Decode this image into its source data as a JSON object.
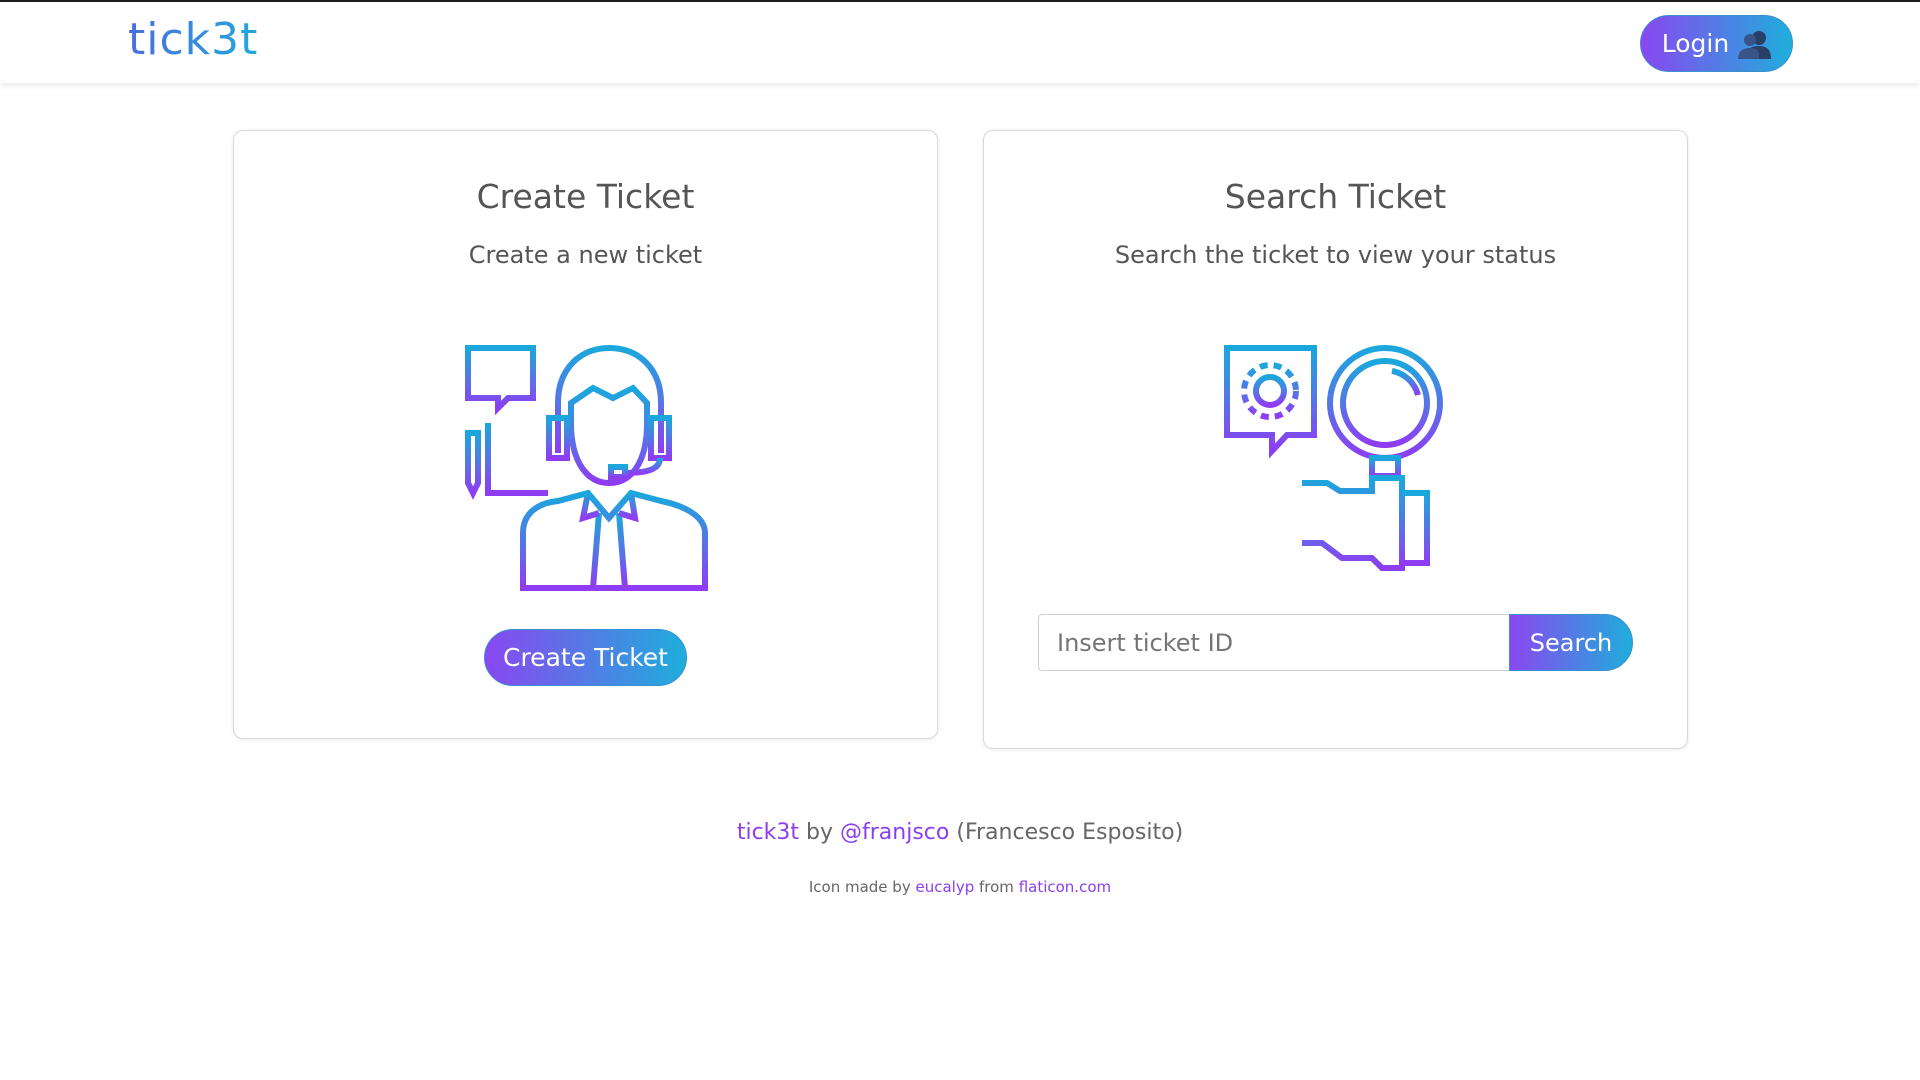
{
  "header": {
    "brand": "tick3t",
    "login_label": "Login"
  },
  "create_card": {
    "title": "Create Ticket",
    "subtitle": "Create a new ticket",
    "button_label": "Create Ticket"
  },
  "search_card": {
    "title": "Search Ticket",
    "subtitle": "Search the ticket to view your status",
    "input_placeholder": "Insert ticket ID",
    "input_value": "",
    "button_label": "Search"
  },
  "footer": {
    "app_name": "tick3t",
    "by_text": " by ",
    "author_handle": "@franjsco",
    "author_name": " (Francesco Esposito)",
    "credits_prefix": "Icon made by ",
    "credits_author": "eucalyp",
    "credits_middle": " from ",
    "credits_site": "flaticon.com"
  },
  "icons": {
    "login": "user-icon",
    "create_illustration": "support-agent-icon",
    "search_illustration": "magnifier-search-icon"
  },
  "colors": {
    "gradient_start": "#8a47f0",
    "gradient_end": "#1eaedb",
    "link": "#8a3ff0",
    "brand": "#4a6fdc"
  }
}
